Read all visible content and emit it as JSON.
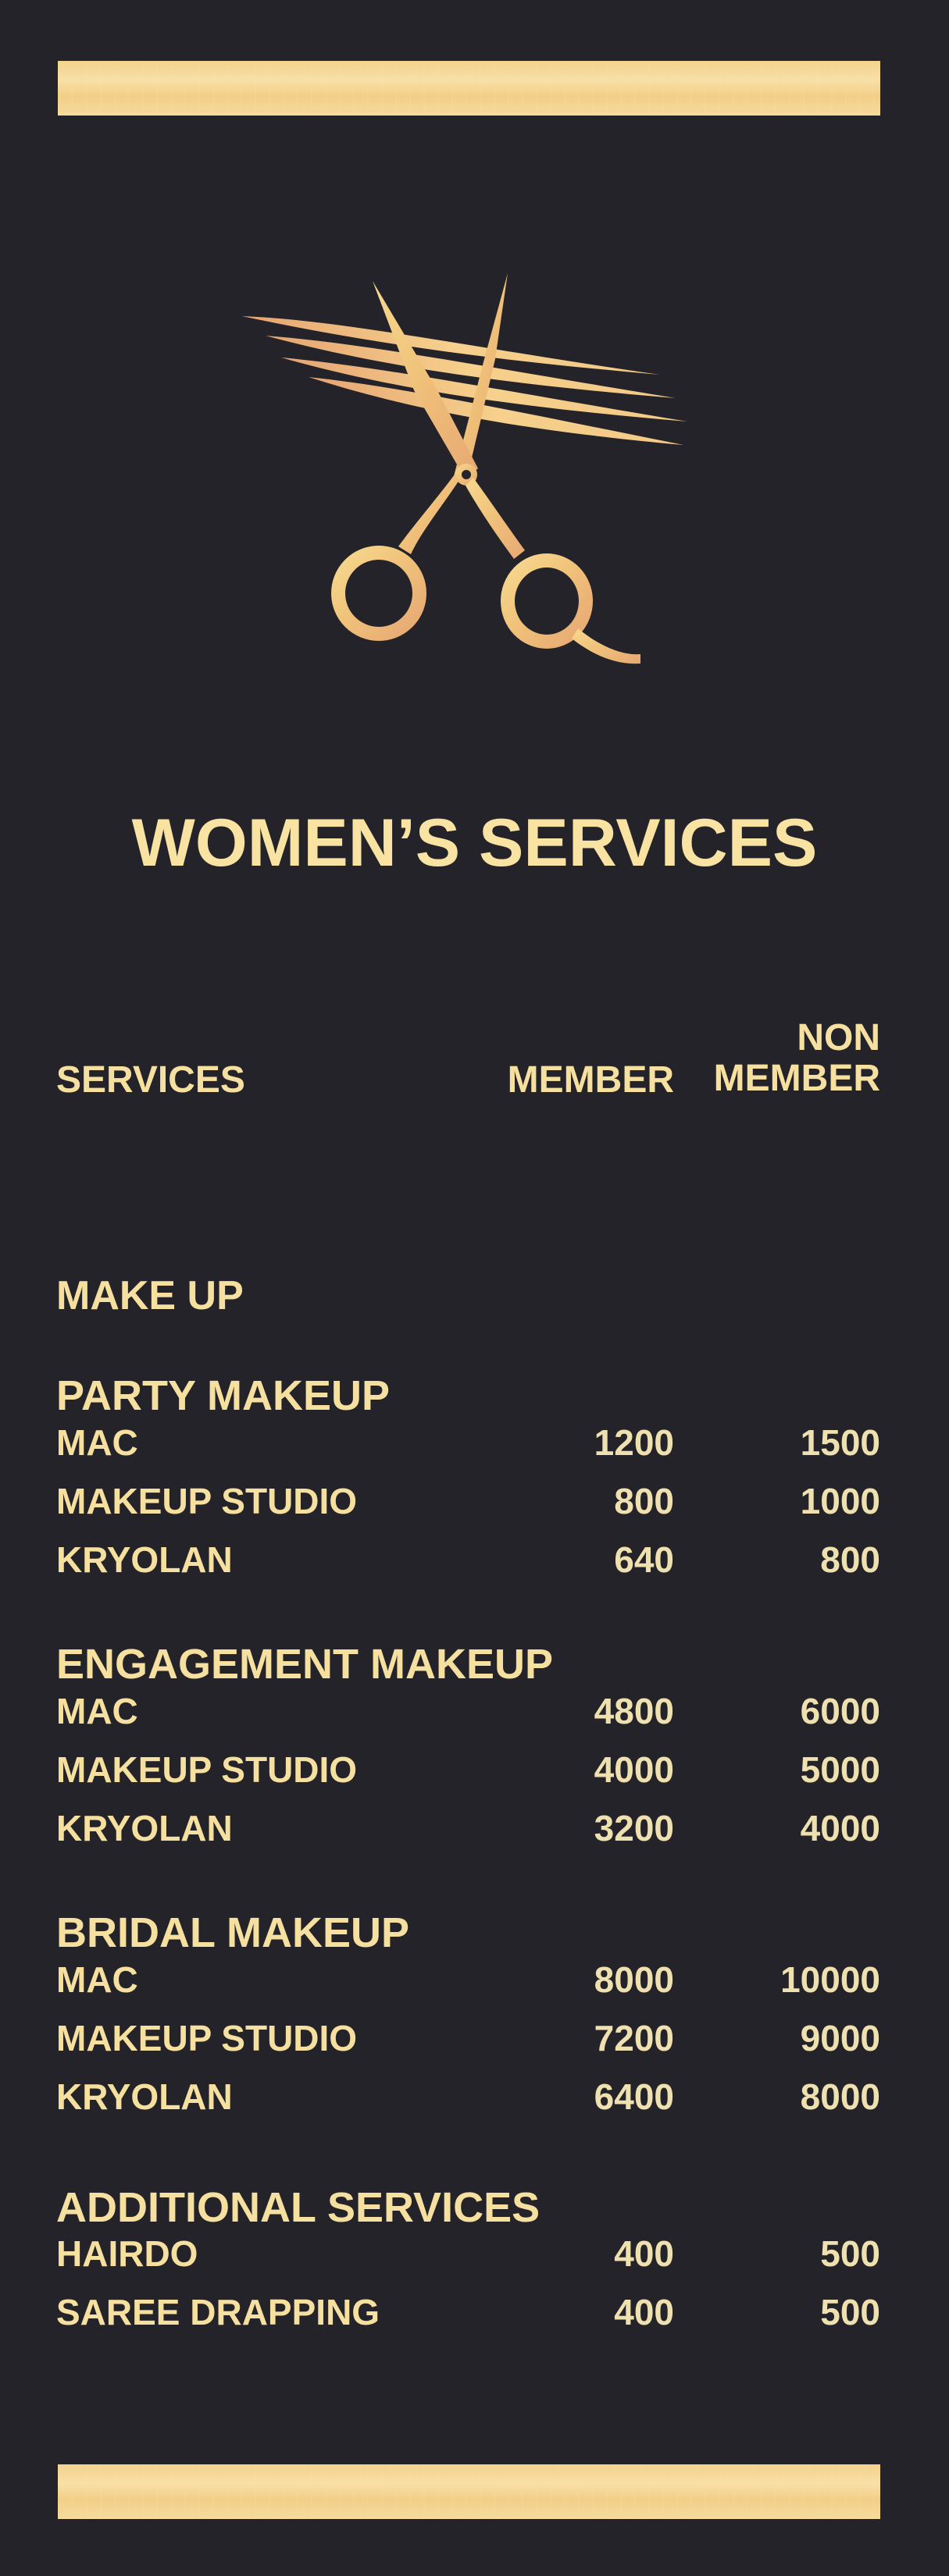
{
  "colors": {
    "background": "#242329",
    "gold": "#f6e0a0",
    "bar": "#f4d594"
  },
  "logo": {
    "icon": "scissors-cutting-hair-icon"
  },
  "title": "WOMEN’S SERVICES",
  "headers": {
    "services": "SERVICES",
    "member": "MEMBER",
    "non_member_line1": "NON",
    "non_member_line2": "MEMBER"
  },
  "section": {
    "title": "MAKE UP"
  },
  "groups": [
    {
      "title": "PARTY MAKEUP",
      "items": [
        {
          "name": "MAC",
          "member": "1200",
          "non_member": "1500"
        },
        {
          "name": "MAKEUP STUDIO",
          "member": "800",
          "non_member": "1000"
        },
        {
          "name": "KRYOLAN",
          "member": "640",
          "non_member": "800"
        }
      ]
    },
    {
      "title": "ENGAGEMENT MAKEUP",
      "items": [
        {
          "name": "MAC",
          "member": "4800",
          "non_member": "6000"
        },
        {
          "name": "MAKEUP STUDIO",
          "member": "4000",
          "non_member": "5000"
        },
        {
          "name": "KRYOLAN",
          "member": "3200",
          "non_member": "4000"
        }
      ]
    },
    {
      "title": "BRIDAL MAKEUP",
      "items": [
        {
          "name": "MAC",
          "member": "8000",
          "non_member": "10000"
        },
        {
          "name": "MAKEUP STUDIO",
          "member": "7200",
          "non_member": "9000"
        },
        {
          "name": "KRYOLAN",
          "member": "6400",
          "non_member": "8000"
        }
      ]
    },
    {
      "title": "ADDITIONAL SERVICES",
      "items": [
        {
          "name": "HAIRDO",
          "member": "400",
          "non_member": "500"
        },
        {
          "name": "SAREE DRAPPING",
          "member": "400",
          "non_member": "500"
        }
      ]
    }
  ]
}
